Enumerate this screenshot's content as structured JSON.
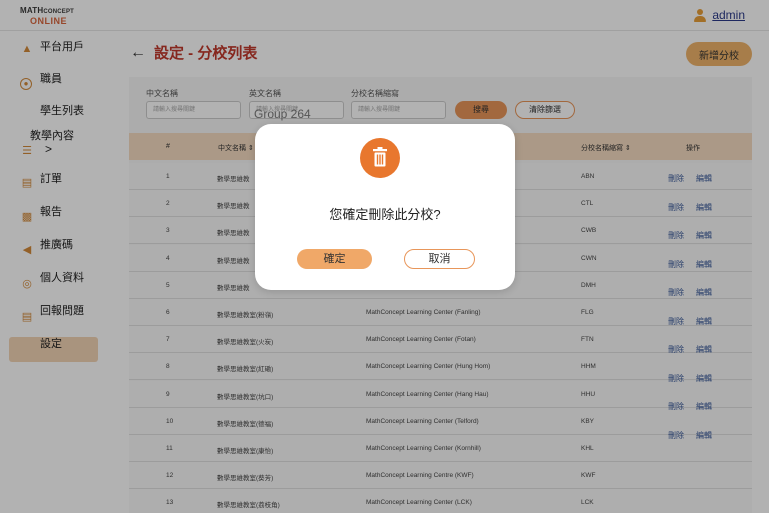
{
  "brand": {
    "line1": "MATH",
    "line1b": "CONCEPT",
    "line2": "ONLINE"
  },
  "user": {
    "name": "admin"
  },
  "sidebar": {
    "items": [
      {
        "label": "平台用戶",
        "icon": "users-icon"
      },
      {
        "label": "職員",
        "icon": "staff-icon"
      },
      {
        "label": "學生列表",
        "icon": ""
      },
      {
        "label": "教學內容",
        "icon": "book-icon",
        "chevron": ">"
      },
      {
        "label": "訂單",
        "icon": "order-icon"
      },
      {
        "label": "報告",
        "icon": "chart-icon"
      },
      {
        "label": "推廣碼",
        "icon": "megaphone-icon"
      },
      {
        "label": "個人資料",
        "icon": "profile-icon"
      },
      {
        "label": "回報問題",
        "icon": "report-icon"
      },
      {
        "label": "設定",
        "icon": ""
      }
    ],
    "active": "設定"
  },
  "page": {
    "title": "設定 - 分校列表",
    "back": "←",
    "add_button": "新增分校"
  },
  "filters": {
    "cn_name": {
      "label": "中文名稱",
      "placeholder": "請輸入搜尋關鍵"
    },
    "en_name": {
      "label": "英文名稱",
      "placeholder": "請輸入搜尋關鍵"
    },
    "abbr": {
      "label": "分校名稱縮寫",
      "placeholder": "請輸入搜尋關鍵"
    },
    "search_button": "搜尋",
    "clear_button": "清除篩選"
  },
  "table": {
    "headers": {
      "num": "#",
      "cn": "中文名稱 ⇕",
      "abbr": "分校名稱縮寫 ⇕",
      "ops": "操作"
    },
    "rows": [
      {
        "n": "1",
        "cn": "數學思維教",
        "en": "",
        "abbr": "ABN"
      },
      {
        "n": "2",
        "cn": "數學思維教",
        "en": "",
        "abbr": "CTL"
      },
      {
        "n": "3",
        "cn": "數學思維教",
        "en": "",
        "abbr": "CWB"
      },
      {
        "n": "4",
        "cn": "數學思維教",
        "en": "",
        "abbr": "CWN"
      },
      {
        "n": "5",
        "cn": "數學思維教",
        "en": "",
        "abbr": "DMH"
      },
      {
        "n": "6",
        "cn": "數學思維教室(粉嶺)",
        "en": "MathConcept Learning Center (Fanling)",
        "abbr": "FLG"
      },
      {
        "n": "7",
        "cn": "數學思維教室(火炭)",
        "en": "MathConcept Learning Center (Fotan)",
        "abbr": "FTN"
      },
      {
        "n": "8",
        "cn": "數學思維教室(紅磡)",
        "en": "MathConcept Learning Center (Hung Hom)",
        "abbr": "HHM"
      },
      {
        "n": "9",
        "cn": "數學思維教室(坑口)",
        "en": "MathConcept Learning Center (Hang Hau)",
        "abbr": "HHU"
      },
      {
        "n": "10",
        "cn": "數學思維教室(德福)",
        "en": "MathConcept Learning Center (Telford)",
        "abbr": "KBY"
      },
      {
        "n": "11",
        "cn": "數學思維教室(康怡)",
        "en": "MathConcept Learning Center (Kornhill)",
        "abbr": "KHL"
      },
      {
        "n": "12",
        "cn": "數學思維教室(葵芳)",
        "en": "MathConcept Learning Centre (KWF)",
        "abbr": "KWF"
      },
      {
        "n": "13",
        "cn": "數學思維教室(荔枝角)",
        "en": "MathConcept Learning Center (LCK)",
        "abbr": "LCK"
      }
    ],
    "actions": {
      "delete": "刪除",
      "edit": "編輯"
    }
  },
  "ghost_label": "Group 264",
  "modal": {
    "icon": "trash-icon",
    "message": "您確定刪除此分校?",
    "confirm": "確定",
    "cancel": "取消"
  }
}
